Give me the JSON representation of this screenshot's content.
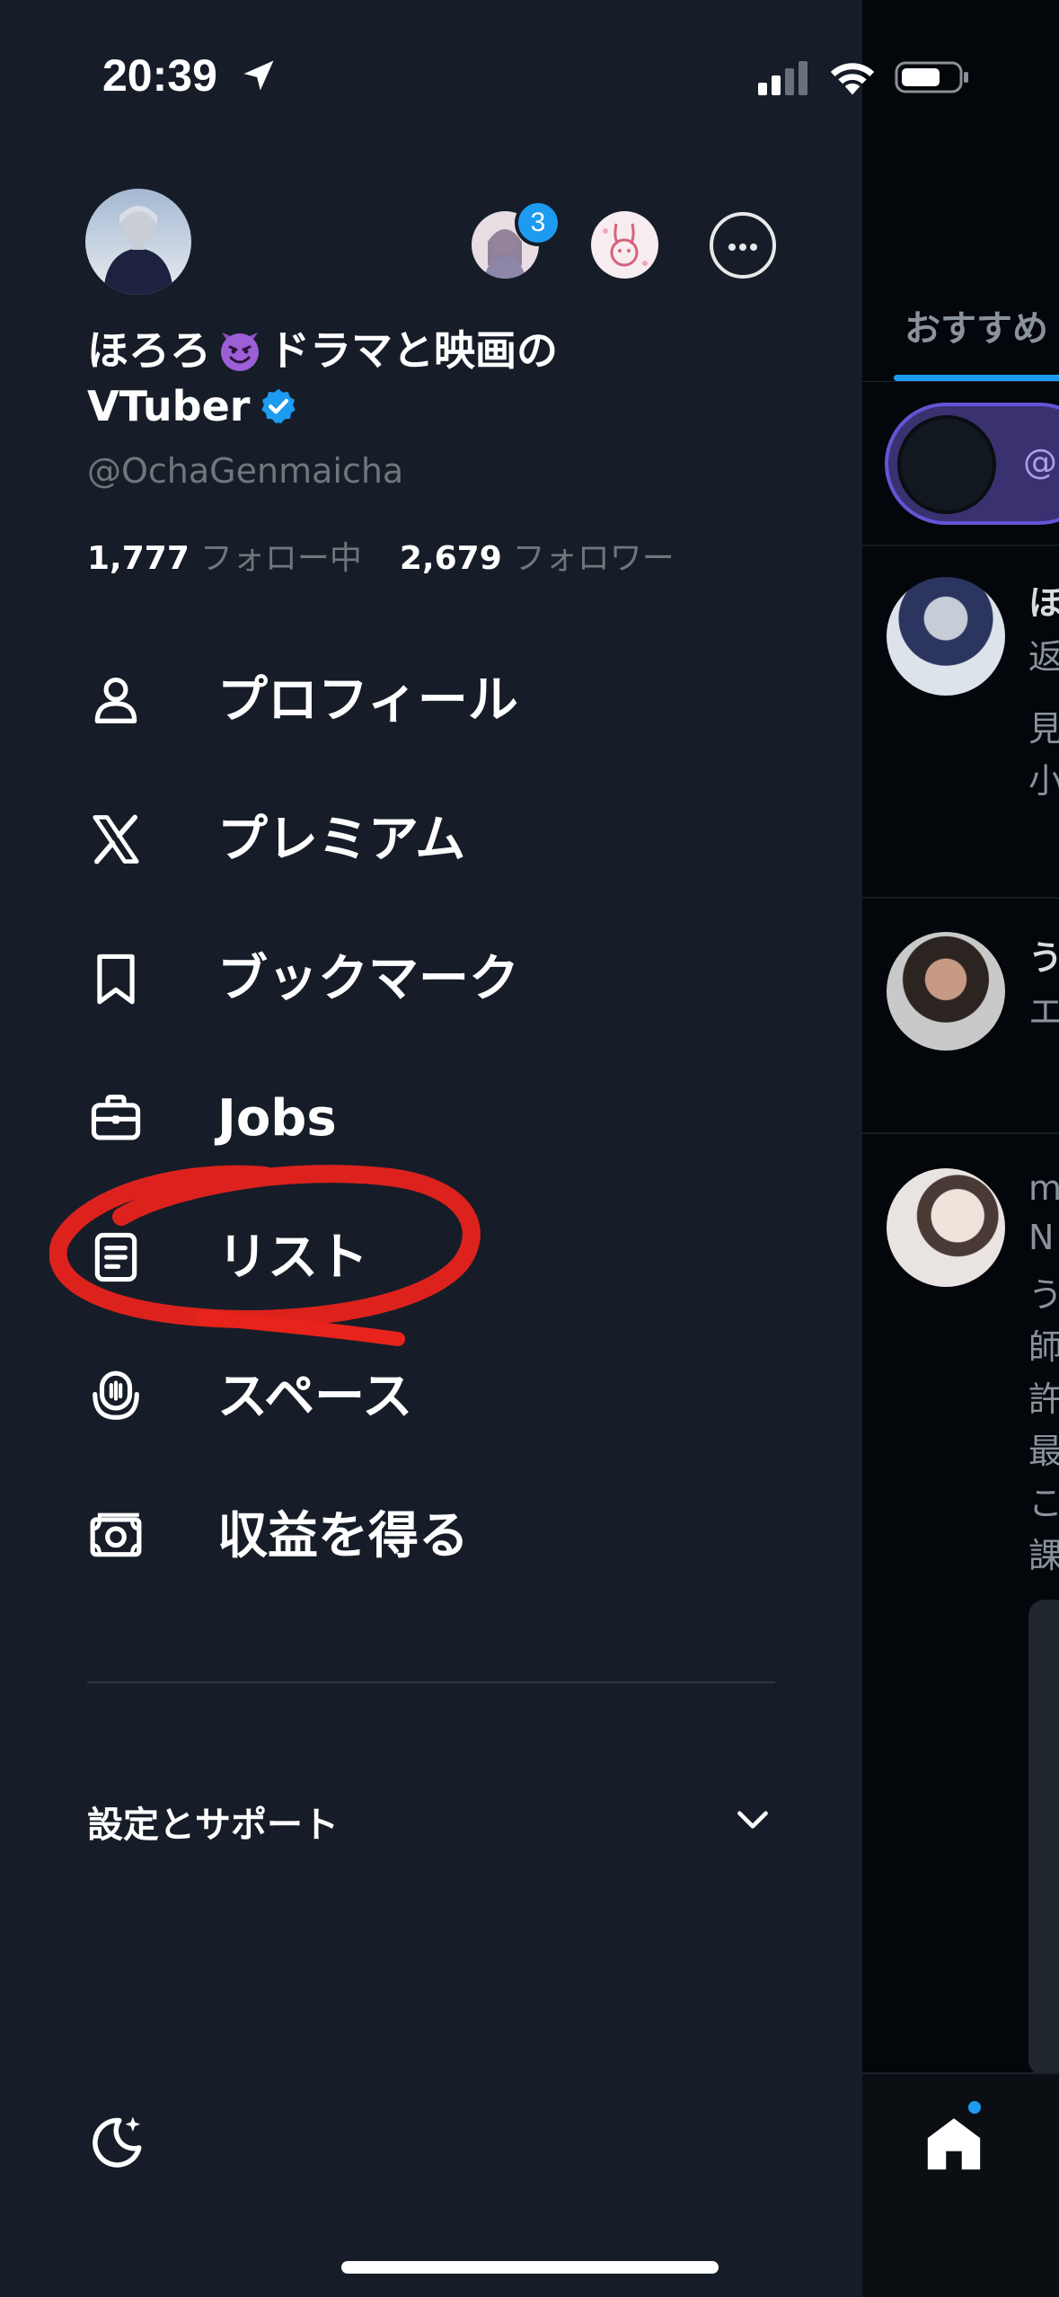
{
  "status_bar": {
    "time": "20:39"
  },
  "profile": {
    "name_line1_pre": "ほろろ",
    "name_line1_post": "ドラマと映画の",
    "name_line2": "VTuber",
    "handle": "@OchaGenmaicha",
    "following_count": "1,777",
    "following_label": "フォロー中",
    "followers_count": "2,679",
    "followers_label": "フォロワー"
  },
  "accounts": {
    "notification_badge": "3"
  },
  "menu": {
    "items": [
      {
        "label": "プロフィール",
        "icon": "person-icon"
      },
      {
        "label": "プレミアム",
        "icon": "x-logo-icon"
      },
      {
        "label": "ブックマーク",
        "icon": "bookmark-icon"
      },
      {
        "label": "Jobs",
        "icon": "briefcase-icon"
      },
      {
        "label": "リスト",
        "icon": "list-icon"
      },
      {
        "label": "スペース",
        "icon": "spaces-icon"
      },
      {
        "label": "収益を得る",
        "icon": "money-icon"
      }
    ]
  },
  "settings": {
    "label": "設定とサポート"
  },
  "background_timeline": {
    "tab_label": "おすすめ",
    "pill_text": "@",
    "tweet1_name": "ほ",
    "tweet1_meta": "返",
    "tweet1_line1": "見",
    "tweet1_line2": "小",
    "tweet2_name": "う",
    "tweet2_meta": "エ",
    "tweet3_name": "m",
    "tweet3_lines": [
      "N",
      "う",
      "師",
      "許",
      "最",
      "こ",
      "課"
    ]
  },
  "colors": {
    "drawer_bg": "#161d28",
    "accent_blue": "#1d9bf0",
    "muted_text": "#71767b",
    "annotation_red": "#e8231c"
  }
}
